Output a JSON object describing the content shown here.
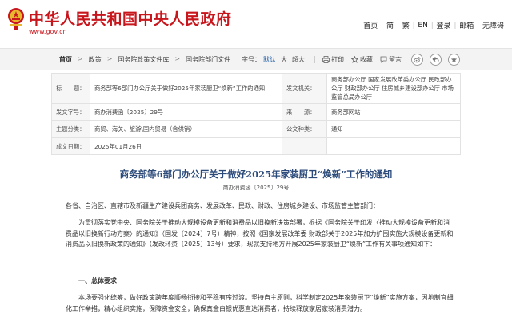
{
  "header": {
    "title": "中华人民共和国中央人民政府",
    "url": "www.gov.cn",
    "nav": [
      "首页",
      "简",
      "繁",
      "EN",
      "登录",
      "邮箱",
      "无障碍"
    ]
  },
  "breadcrumb": [
    "首页",
    "政策",
    "国务院政策文件库",
    "国务院部门文件"
  ],
  "tools": {
    "font_label": "字号：",
    "sizes": [
      "默认",
      "大",
      "超大"
    ],
    "print": "打印",
    "favorite": "收藏",
    "comment": "留言"
  },
  "meta": {
    "title_key": "标　　题：",
    "title_val": "商务部等6部门办公厅关于做好2025年家装厨卫“焕新”工作的通知",
    "issuer_key": "发文机关：",
    "issuer_val": "商务部办公厅  国家发展改革委办公厅  民政部办公厅  财政部办公厅  住房城乡建设部办公厅  市场监管总局办公厅",
    "docno_key": "发文字号：",
    "docno_val": "商办消费函〔2025〕29号",
    "source_key": "来　　源：",
    "source_val": "商务部网站",
    "topic_key": "主题分类：",
    "topic_val": "商贸、海关、旅游\\国内贸易（含供销）",
    "type_key": "公文种类：",
    "type_val": "通知",
    "date_key": "成文日期：",
    "date_val": "2025年01月26日"
  },
  "article": {
    "title": "商务部等6部门办公厅关于做好2025年家装厨卫“焕新”工作的通知",
    "docno": "商办消费函〔2025〕29号",
    "addressee": "各省、自治区、直辖市及新疆生产建设兵团商务、发展改革、民政、财政、住房城乡建设、市场监管主管部门：",
    "para1": "为贯彻落实党中央、国务院关于推动大规模设备更新和消费品以旧换新决策部署，根据《国务院关于印发〈推动大规模设备更新和消费品以旧换新行动方案〉的通知》（国发〔2024〕7号）精神，按照《国家发展改革委 财政部关于2025年加力扩围实施大规模设备更新和消费品以旧换新政策的通知》（发改环资〔2025〕13号）要求，现就支持地方开展2025年家装厨卫“焕新”工作有关事项通知如下：",
    "section1": "一、总体要求",
    "para2": "本场要强化统筹，做好政策跨年度顺畅衔接和平稳有序过渡。坚持自主原则，科学制定2025年家装厨卫“焕新”实施方案，因地制宜细化工作举措，精心组织实施，保障资金安全，确保真金白银优惠直达消费者，持续释放家居家装消费潜力。"
  },
  "colors": {
    "brand_red": "#c8161d",
    "title_blue": "#2b4a7a",
    "link_blue": "#1a5aa8"
  }
}
